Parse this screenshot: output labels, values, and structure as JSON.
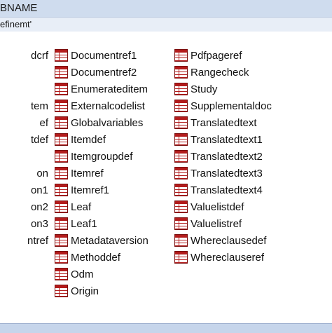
{
  "header": {
    "title": "BNAME"
  },
  "filter": {
    "text": "efinemt'"
  },
  "list": {
    "left_column": [
      "dcrf",
      "tem",
      "ef",
      "tdef",
      "on",
      "on1",
      "on2",
      "on3",
      "ntref"
    ],
    "middle_column": [
      "Documentref1",
      "Documentref2",
      "Enumerateditem",
      "Externalcodelist",
      "Globalvariables",
      "Itemdef",
      "Itemgroupdef",
      "Itemref",
      "Itemref1",
      "Leaf",
      "Leaf1",
      "Metadataversion",
      "Methoddef",
      "Odm",
      "Origin"
    ],
    "right_column": [
      "Pdfpageref",
      "Rangecheck",
      "Study",
      "Supplementaldoc",
      "Translatedtext",
      "Translatedtext1",
      "Translatedtext2",
      "Translatedtext3",
      "Translatedtext4",
      "Valuelistdef",
      "Valuelistref",
      "Whereclausedef",
      "Whereclauseref"
    ]
  },
  "icons": {
    "table": "table-icon"
  },
  "colors": {
    "icon_red": "#b31b1b",
    "header_bg": "#cfdcee"
  }
}
